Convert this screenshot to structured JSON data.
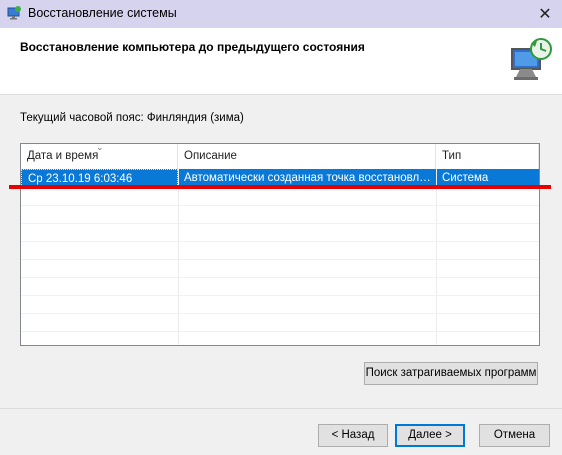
{
  "window": {
    "title": "Восстановление системы",
    "close_glyph": "✕",
    "icon": "system-restore-icon"
  },
  "header": {
    "title": "Восстановление компьютера до предыдущего состояния",
    "icon": "system-restore-monitor-icon"
  },
  "timezone_text": "Текущий часовой пояс: Финляндия (зима)",
  "restore_points": {
    "columns": [
      "Дата и время",
      "Описание",
      "Тип"
    ],
    "rows": [
      {
        "date": "Ср 23.10.19 6:03:46",
        "description": "Автоматически созданная точка восстановления",
        "type": "Система",
        "selected": true
      }
    ],
    "selection_color": "#0a78d7"
  },
  "annotation_color": "#e60000",
  "buttons": {
    "scan": "Поиск затрагиваемых программ",
    "back": "< Назад",
    "next": "Далее >",
    "cancel": "Отмена"
  }
}
